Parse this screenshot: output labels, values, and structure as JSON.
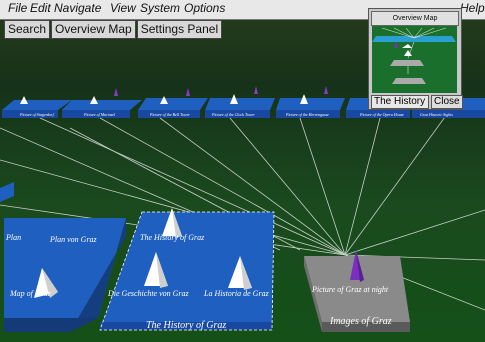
{
  "menubar": {
    "items": [
      "File",
      "Edit",
      "Navigate",
      "View",
      "System",
      "Options"
    ],
    "help": "Help"
  },
  "toolbar": {
    "buttons": [
      "Search",
      "Overview Map",
      "Settings Panel"
    ]
  },
  "overview": {
    "title": "Overview Map",
    "current": "The History of Graz",
    "close": "Close"
  },
  "scene": {
    "far_labels": [
      "Picture of Stagerdorf",
      "Picture of Murinsel",
      "Picture of the Bell Tower",
      "Picture of the Clock Tower",
      "Picture of the Herrengasse",
      "Picture of the Opera House",
      "Graz Historic Sights"
    ],
    "left_block": {
      "title": "Plan von Graz",
      "items": [
        "Plan",
        "Map of Graz"
      ]
    },
    "history_block": {
      "title": "The History of Graz",
      "items": [
        "The History of Graz",
        "Die Geschichte von Graz",
        "La Historia de Graz"
      ]
    },
    "images_block": {
      "title": "Images of Graz",
      "items": [
        "Picture of Graz at night"
      ]
    }
  },
  "colors": {
    "blue": "#1f5fbf",
    "grey": "#808080",
    "ground": "#1a4a1e"
  }
}
